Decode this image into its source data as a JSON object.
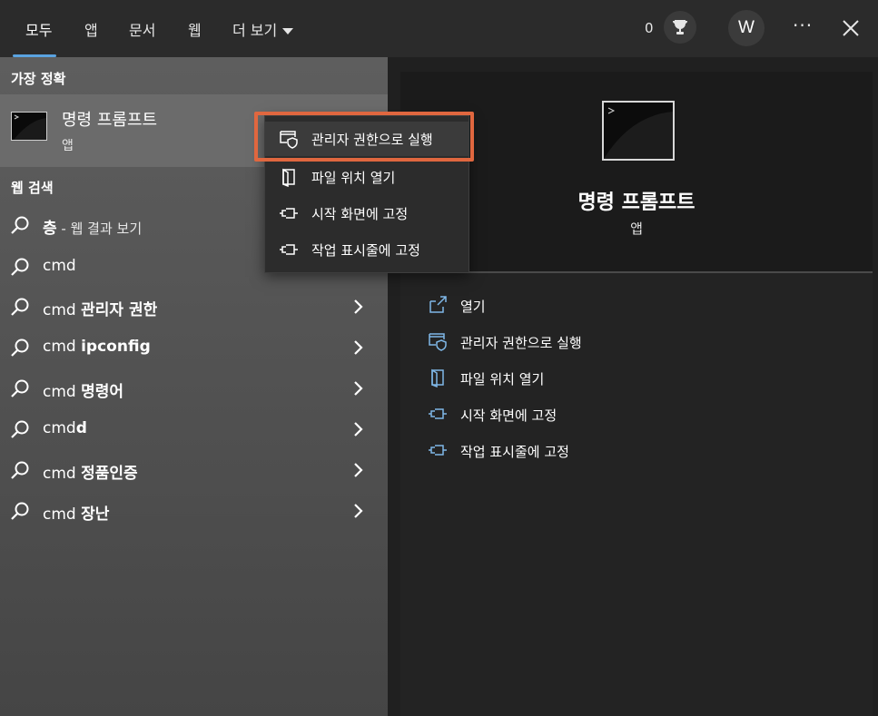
{
  "tabs": [
    {
      "label": "모두"
    },
    {
      "label": "앱"
    },
    {
      "label": "문서"
    },
    {
      "label": "웹"
    },
    {
      "label": "더 보기"
    }
  ],
  "header": {
    "points": "0",
    "avatar_initial": "W",
    "more": "···"
  },
  "best_match": {
    "section_label": "가장 정확",
    "title": "명령 프롬프트",
    "subtitle": "앱"
  },
  "web_search": {
    "section_label": "웹 검색",
    "query_row": {
      "bold": "층",
      "rest": " - 웹 결과 보기"
    },
    "items": [
      {
        "prefix": "cmd",
        "bold": ""
      },
      {
        "prefix": "cmd ",
        "bold": "관리자 권한"
      },
      {
        "prefix": "cmd ",
        "bold": "ipconfig"
      },
      {
        "prefix": "cmd ",
        "bold": "명령어"
      },
      {
        "prefix": "cmd",
        "bold": "d"
      },
      {
        "prefix": "cmd ",
        "bold": "정품인증"
      },
      {
        "prefix": "cmd ",
        "bold": "장난"
      }
    ]
  },
  "context_menu": {
    "items": [
      {
        "label": "관리자 권한으로 실행",
        "icon": "shield-window-icon"
      },
      {
        "label": "파일 위치 열기",
        "icon": "folder-open-icon"
      },
      {
        "label": "시작 화면에 고정",
        "icon": "pin-icon"
      },
      {
        "label": "작업 표시줄에 고정",
        "icon": "pin-icon"
      }
    ]
  },
  "details": {
    "title": "명령 프롬프트",
    "subtitle": "앱",
    "actions": [
      {
        "label": "열기",
        "icon": "open-icon"
      },
      {
        "label": "관리자 권한으로 실행",
        "icon": "shield-window-icon"
      },
      {
        "label": "파일 위치 열기",
        "icon": "folder-open-icon"
      },
      {
        "label": "시작 화면에 고정",
        "icon": "pin-icon"
      },
      {
        "label": "작업 표시줄에 고정",
        "icon": "pin-icon"
      }
    ]
  },
  "colors": {
    "accent": "#5aa3e0",
    "highlight_border": "#e0673f",
    "icon_blue": "#7fb8e8"
  }
}
